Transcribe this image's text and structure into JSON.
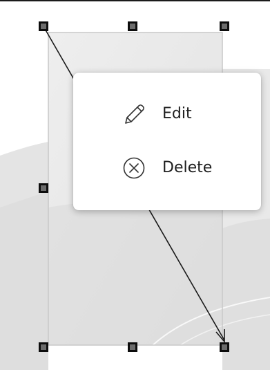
{
  "context_menu": {
    "items": [
      {
        "label": "Edit",
        "icon": "pencil-icon"
      },
      {
        "label": "Delete",
        "icon": "circle-x-icon"
      }
    ]
  },
  "selection": {
    "handle_color": "#6b6b6b",
    "handle_border_color": "#0d0d0d",
    "frame_color": "#c8c8c8"
  }
}
